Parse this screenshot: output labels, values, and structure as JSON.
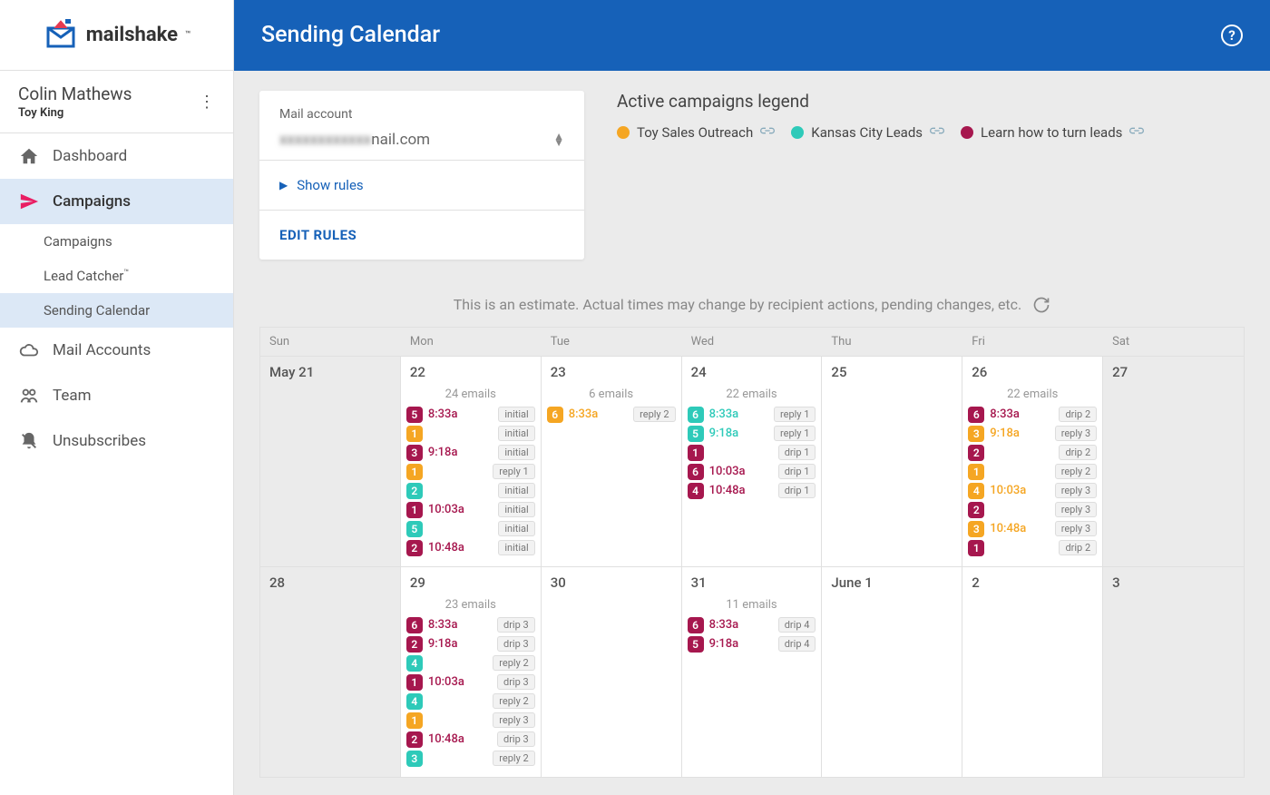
{
  "brand": {
    "name": "mailshake"
  },
  "profile": {
    "name": "Colin Mathews",
    "sub": "Toy King"
  },
  "nav": {
    "dashboard": "Dashboard",
    "campaigns": "Campaigns",
    "sub": {
      "campaigns": "Campaigns",
      "lead_catcher": "Lead Catcher",
      "sending_calendar": "Sending Calendar"
    },
    "mail_accounts": "Mail Accounts",
    "team": "Team",
    "unsubscribes": "Unsubscribes"
  },
  "header": {
    "title": "Sending Calendar"
  },
  "card": {
    "label": "Mail account",
    "value": "xxxxxxxxxxxx",
    "suffix": "nail.com",
    "show_rules": "Show rules",
    "edit_rules": "EDIT RULES"
  },
  "legend": {
    "title": "Active campaigns legend",
    "items": [
      {
        "label": "Toy Sales Outreach",
        "color": "#f5a623"
      },
      {
        "label": "Kansas City Leads",
        "color": "#2ecab9"
      },
      {
        "label": "Learn how to turn leads",
        "color": "#a6174e"
      }
    ]
  },
  "disclaimer": "This is an estimate. Actual times may change by recipient actions, pending changes, etc.",
  "days": [
    "Sun",
    "Mon",
    "Tue",
    "Wed",
    "Thu",
    "Fri",
    "Sat"
  ],
  "cells": [
    {
      "date": "May  21",
      "weekend": true,
      "summary": "",
      "events": []
    },
    {
      "date": "22",
      "weekend": false,
      "summary": "24 emails",
      "events": [
        {
          "n": "5",
          "c": "magenta",
          "time": "8:33a",
          "tag": "initial"
        },
        {
          "n": "1",
          "c": "orange",
          "time": "",
          "tag": "initial"
        },
        {
          "n": "3",
          "c": "magenta",
          "time": "9:18a",
          "tag": "initial"
        },
        {
          "n": "1",
          "c": "orange",
          "time": "",
          "tag": "reply 1"
        },
        {
          "n": "2",
          "c": "teal",
          "time": "",
          "tag": "initial"
        },
        {
          "n": "1",
          "c": "magenta",
          "time": "10:03a",
          "tag": "initial"
        },
        {
          "n": "5",
          "c": "teal",
          "time": "",
          "tag": "initial"
        },
        {
          "n": "2",
          "c": "magenta",
          "time": "10:48a",
          "tag": "initial"
        }
      ]
    },
    {
      "date": "23",
      "weekend": false,
      "summary": "6 emails",
      "events": [
        {
          "n": "6",
          "c": "orange",
          "time": "8:33a",
          "tag": "reply 2"
        }
      ]
    },
    {
      "date": "24",
      "weekend": false,
      "summary": "22 emails",
      "events": [
        {
          "n": "6",
          "c": "teal",
          "time": "8:33a",
          "tag": "reply 1"
        },
        {
          "n": "5",
          "c": "teal",
          "time": "9:18a",
          "tag": "reply 1"
        },
        {
          "n": "1",
          "c": "magenta",
          "time": "",
          "tag": "drip 1"
        },
        {
          "n": "6",
          "c": "magenta",
          "time": "10:03a",
          "tag": "drip 1"
        },
        {
          "n": "4",
          "c": "magenta",
          "time": "10:48a",
          "tag": "drip 1"
        }
      ]
    },
    {
      "date": "25",
      "weekend": false,
      "summary": "",
      "events": []
    },
    {
      "date": "26",
      "weekend": false,
      "summary": "22 emails",
      "events": [
        {
          "n": "6",
          "c": "magenta",
          "time": "8:33a",
          "tag": "drip 2"
        },
        {
          "n": "3",
          "c": "orange",
          "time": "9:18a",
          "tag": "reply 3"
        },
        {
          "n": "2",
          "c": "magenta",
          "time": "",
          "tag": "drip 2"
        },
        {
          "n": "1",
          "c": "orange",
          "time": "",
          "tag": "reply 2"
        },
        {
          "n": "4",
          "c": "orange",
          "time": "10:03a",
          "tag": "reply 3"
        },
        {
          "n": "2",
          "c": "magenta",
          "time": "",
          "tag": "reply 3"
        },
        {
          "n": "3",
          "c": "orange",
          "time": "10:48a",
          "tag": "reply 3"
        },
        {
          "n": "1",
          "c": "magenta",
          "time": "",
          "tag": "drip 2"
        }
      ]
    },
    {
      "date": "27",
      "weekend": true,
      "summary": "",
      "events": []
    },
    {
      "date": "28",
      "weekend": true,
      "summary": "",
      "events": []
    },
    {
      "date": "29",
      "weekend": false,
      "summary": "23 emails",
      "events": [
        {
          "n": "6",
          "c": "magenta",
          "time": "8:33a",
          "tag": "drip 3"
        },
        {
          "n": "2",
          "c": "magenta",
          "time": "9:18a",
          "tag": "drip 3"
        },
        {
          "n": "4",
          "c": "teal",
          "time": "",
          "tag": "reply 2"
        },
        {
          "n": "1",
          "c": "magenta",
          "time": "10:03a",
          "tag": "drip 3"
        },
        {
          "n": "4",
          "c": "teal",
          "time": "",
          "tag": "reply 2"
        },
        {
          "n": "1",
          "c": "orange",
          "time": "",
          "tag": "reply 3"
        },
        {
          "n": "2",
          "c": "magenta",
          "time": "10:48a",
          "tag": "drip 3"
        },
        {
          "n": "3",
          "c": "teal",
          "time": "",
          "tag": "reply 2"
        }
      ]
    },
    {
      "date": "30",
      "weekend": false,
      "summary": "",
      "events": []
    },
    {
      "date": "31",
      "weekend": false,
      "summary": "11 emails",
      "events": [
        {
          "n": "6",
          "c": "magenta",
          "time": "8:33a",
          "tag": "drip 4"
        },
        {
          "n": "5",
          "c": "magenta",
          "time": "9:18a",
          "tag": "drip 4"
        }
      ]
    },
    {
      "date": "June  1",
      "weekend": false,
      "summary": "",
      "events": []
    },
    {
      "date": "2",
      "weekend": false,
      "summary": "",
      "events": []
    },
    {
      "date": "3",
      "weekend": true,
      "summary": "",
      "events": []
    }
  ]
}
